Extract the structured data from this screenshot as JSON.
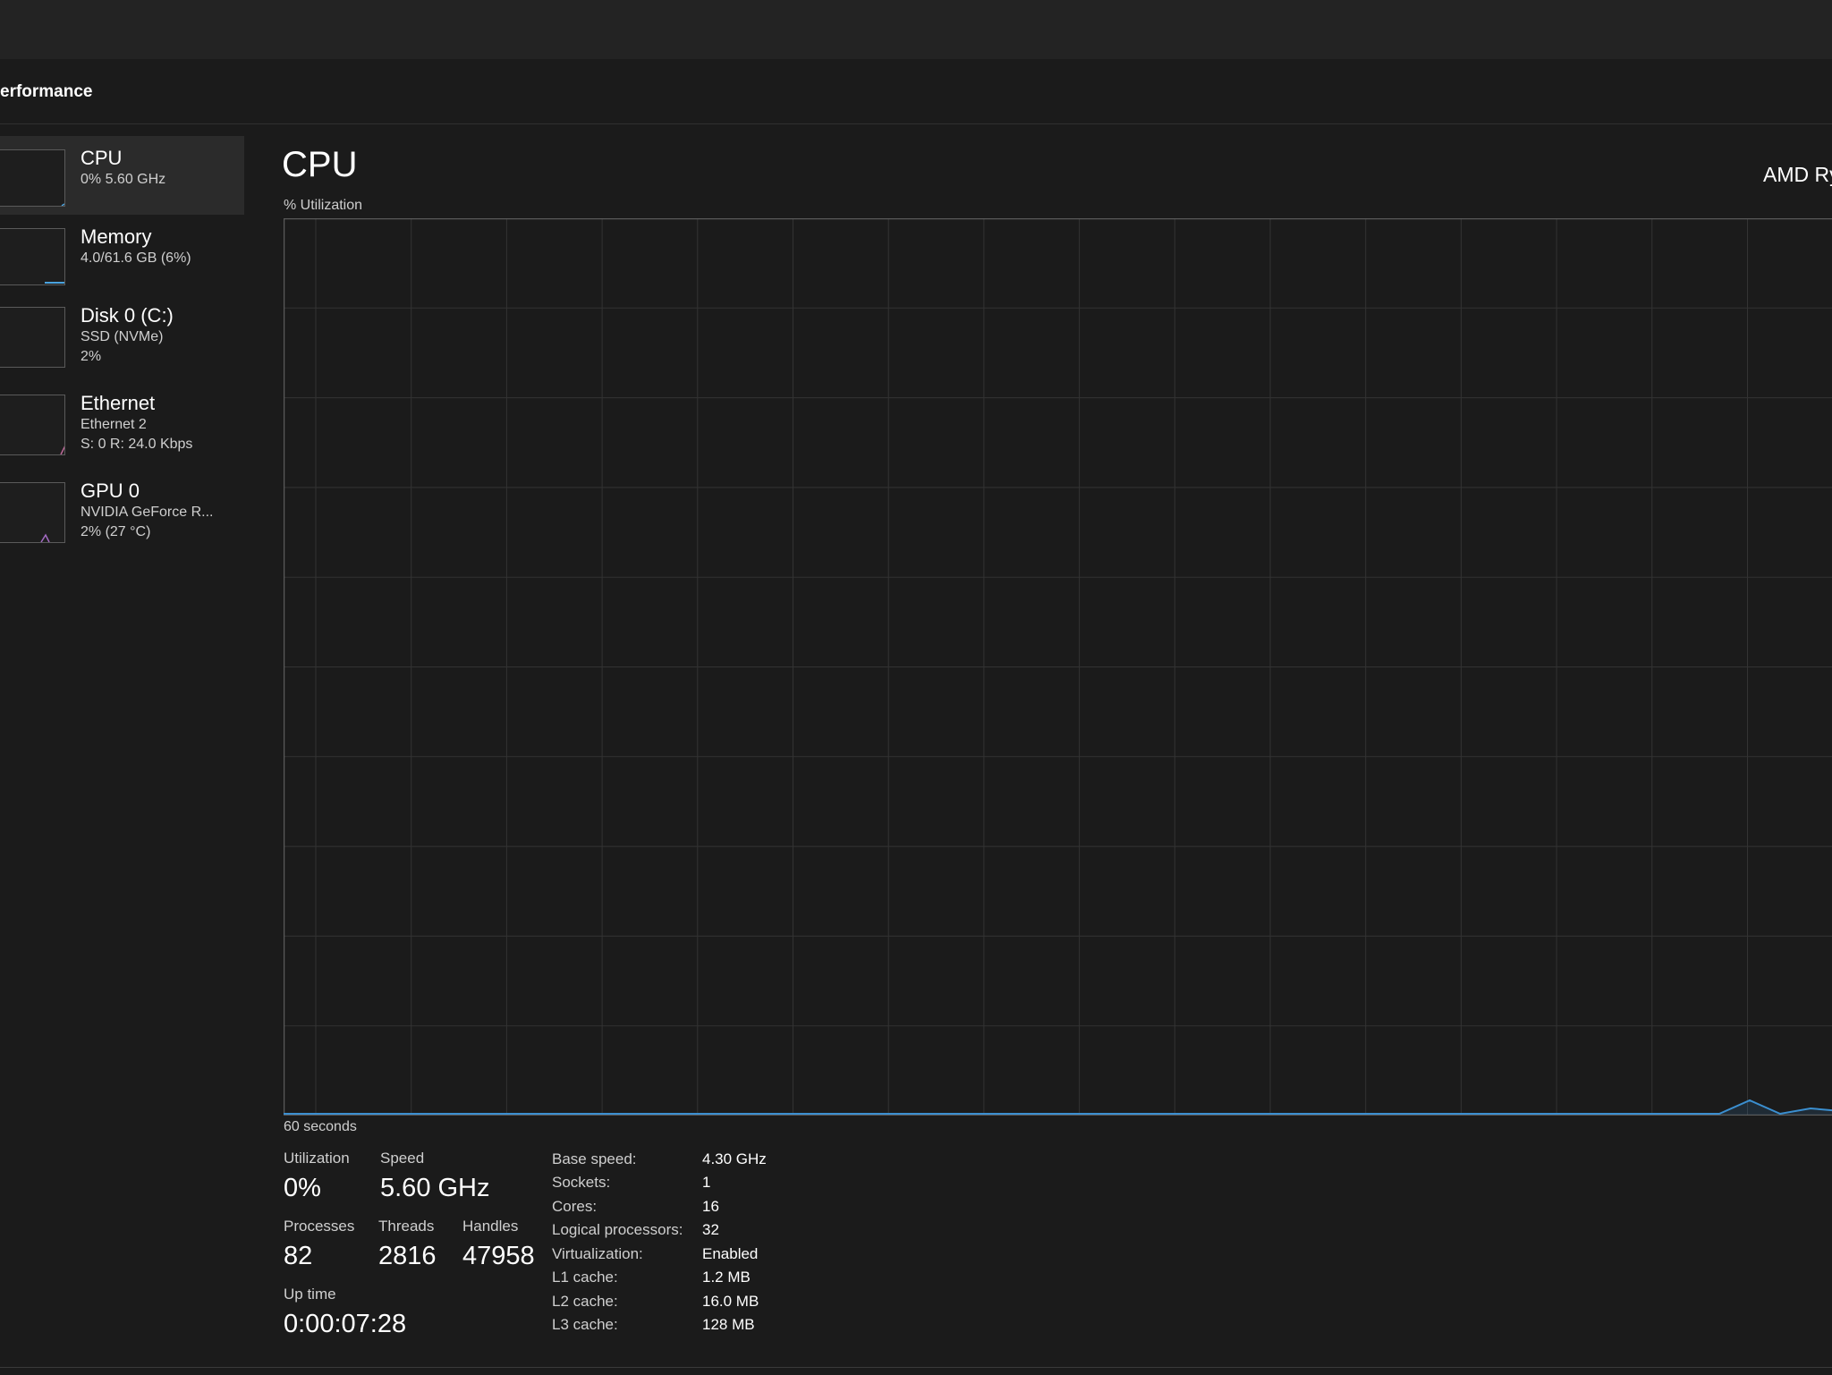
{
  "header": {
    "title": "erformance"
  },
  "sidebar": {
    "items": [
      {
        "name": "CPU",
        "line1": "0%  5.60 GHz",
        "line2": "",
        "color": "#4aa3df"
      },
      {
        "name": "Memory",
        "line1": "4.0/61.6 GB (6%)",
        "line2": "",
        "color": "#4aa3df"
      },
      {
        "name": "Disk 0 (C:)",
        "line1": "SSD (NVMe)",
        "line2": "2%",
        "color": "#a46bc4"
      },
      {
        "name": "Ethernet",
        "line1": "Ethernet 2",
        "line2": "S: 0  R: 24.0 Kbps",
        "color": "#c06a9a"
      },
      {
        "name": "GPU 0",
        "line1": "NVIDIA GeForce R...",
        "line2": "2%  (27 °C)",
        "color": "#a46bc4"
      }
    ]
  },
  "main": {
    "title": "CPU",
    "model": "AMD Ry",
    "graph_label": "% Utilization",
    "graph_footer": "60 seconds",
    "graph_line_color": "#3b8fd0",
    "grid_color": "#333333",
    "border_color": "#5a5a5a"
  },
  "stats": {
    "utilization_label": "Utilization",
    "utilization_value": "0%",
    "speed_label": "Speed",
    "speed_value": "5.60 GHz",
    "processes_label": "Processes",
    "processes_value": "82",
    "threads_label": "Threads",
    "threads_value": "2816",
    "handles_label": "Handles",
    "handles_value": "47958",
    "uptime_label": "Up time",
    "uptime_value": "0:00:07:28"
  },
  "specs": [
    {
      "key": "Base speed:",
      "value": "4.30 GHz"
    },
    {
      "key": "Sockets:",
      "value": "1"
    },
    {
      "key": "Cores:",
      "value": "16"
    },
    {
      "key": "Logical processors:",
      "value": "32"
    },
    {
      "key": "Virtualization:",
      "value": "Enabled"
    },
    {
      "key": "L1 cache:",
      "value": "1.2 MB"
    },
    {
      "key": "L2 cache:",
      "value": "16.0 MB"
    },
    {
      "key": "L3 cache:",
      "value": "128 MB"
    }
  ],
  "chart_data": {
    "type": "line",
    "ylim": [
      0,
      100
    ],
    "xlabel": "60 seconds",
    "ylabel": "% Utilization",
    "grid": true,
    "series": [
      {
        "values": [
          0,
          0,
          0,
          0,
          0,
          0,
          0,
          0,
          0,
          0,
          0,
          0,
          0,
          0,
          0,
          0,
          0,
          0,
          0,
          0,
          0,
          0,
          0,
          0,
          0,
          0,
          0,
          0,
          0,
          0,
          0,
          0,
          0,
          0,
          0,
          0,
          0,
          0,
          0,
          0,
          0,
          0,
          0,
          0,
          0,
          0,
          0,
          0,
          0,
          0,
          0,
          0,
          0,
          0,
          0,
          0,
          1.5,
          0,
          0.6,
          0.3
        ]
      }
    ]
  }
}
